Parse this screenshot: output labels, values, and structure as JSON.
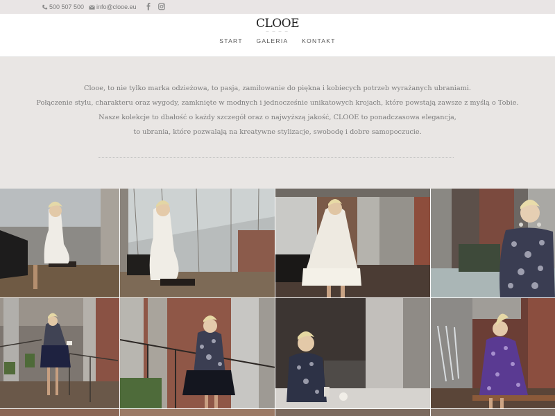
{
  "topbar": {
    "phone": "500 507 500",
    "email": "info@clooe.eu",
    "social": [
      "facebook-icon",
      "instagram-icon"
    ]
  },
  "header": {
    "logo": "CLOOE",
    "nav": [
      "START",
      "GALERIA",
      "KONTAKT"
    ]
  },
  "intro": {
    "lines": [
      "Clooe, to nie tylko marka odzieżowa, to pasja, zamiłowanie do piękna i kobiecych potrzeb wyrażanych ubraniami.",
      "Połączenie stylu, charakteru oraz wygody, zamknięte w modnych i jednocześnie unikatowych krojach, które powstają zawsze z myślą o Tobie.",
      "Nasze kolekcje to dbałość o każdy szczegół oraz o najwyższą jakość, CLOOE to ponadczasowa elegancja,",
      "to ubrania, które pozwalają na kreatywne stylizacje, swobodę i dobre samopoczucie."
    ]
  },
  "colors": {
    "topbar_bg": "#e9e5e5",
    "intro_bg": "#e9e6e4",
    "text": "#7c7c7c"
  }
}
